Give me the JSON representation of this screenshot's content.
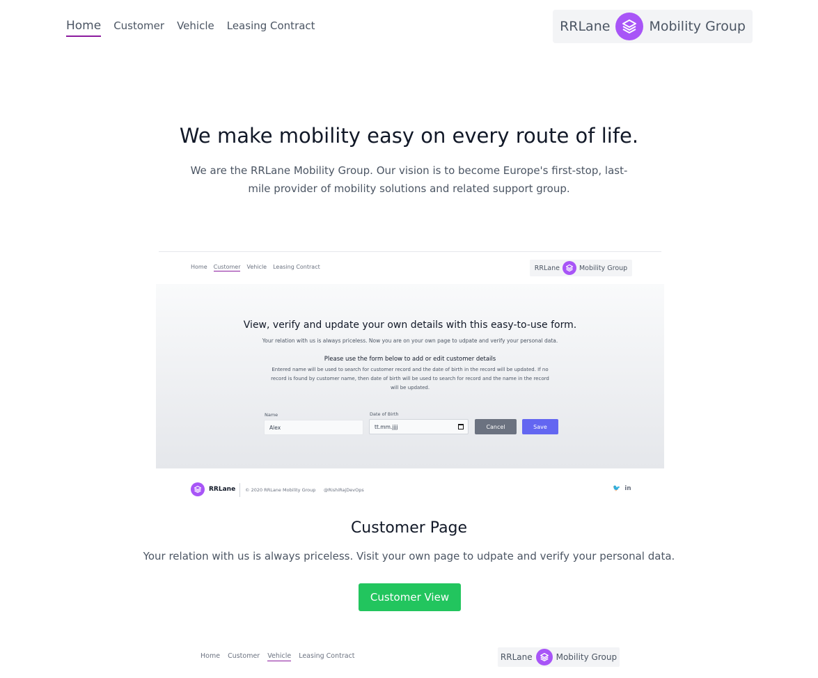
{
  "nav": {
    "items": [
      {
        "label": "Home",
        "active": true
      },
      {
        "label": "Customer",
        "active": false
      },
      {
        "label": "Vehicle",
        "active": false
      },
      {
        "label": "Leasing Contract",
        "active": false
      }
    ]
  },
  "brand": {
    "left": "RRLane",
    "right": "Mobility Group",
    "icon": "layers-icon"
  },
  "hero": {
    "title": "We make mobility easy on every route of life.",
    "subtitle": "We are the RRLane Mobility Group. Our vision is to become Europe's first-stop, last-mile provider of mobility solutions and related support group."
  },
  "preview": {
    "nav": [
      "Home",
      "Customer",
      "Vehicle",
      "Leasing Contract"
    ],
    "brand_left": "RRLane",
    "brand_right": "Mobility Group",
    "title": "View, verify and update your own details with this easy-to-use form.",
    "subtitle": "Your relation with us is always priceless. Now you are on your own page to udpate and verify your personal data.",
    "form_title": "Please use the form below to add or edit customer details",
    "note": "Entered name will be used to search for customer record and the date of birth in the record will be updated. If no record is found by customer name, then date of birth will be used to search for record and the name in the record will be updated.",
    "name_label": "Name",
    "name_value": "Alex",
    "dob_label": "Date of Birth",
    "dob_value": "tt.mm.jjjj",
    "cancel": "Cancel",
    "save": "Save",
    "footer_name": "RRLane",
    "footer_copy": "© 2020 RRLane Mobility Group",
    "footer_handle": "@RishiRajDevOps",
    "social": [
      "twitter-icon",
      "linkedin-icon"
    ]
  },
  "customer_section": {
    "title": "Customer Page",
    "subtitle": "Your relation with us is always priceless. Visit your own page to udpate and verify your personal data.",
    "button": "Customer View"
  },
  "next_preview": {
    "nav": [
      "Home",
      "Customer",
      "Vehicle",
      "Leasing Contract"
    ],
    "brand_left": "RRLane",
    "brand_right": "Mobility Group"
  },
  "colors": {
    "accent": "#a855f7",
    "nav_underline": "#8b1a9e",
    "cta": "#22c55e",
    "save": "#6366f1",
    "cancel": "#6b7280"
  }
}
